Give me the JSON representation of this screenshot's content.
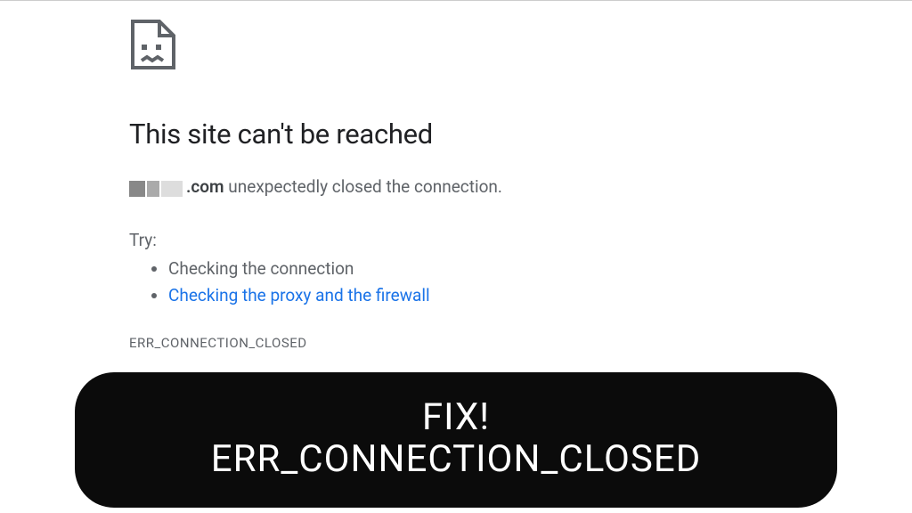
{
  "error": {
    "heading": "This site can't be reached",
    "domain_suffix": ".com",
    "message_rest": " unexpectedly closed the connection.",
    "try_label": "Try:",
    "suggestions": {
      "check_connection": "Checking the connection",
      "check_proxy_firewall": "Checking the proxy and the firewall"
    },
    "error_code": "ERR_CONNECTION_CLOSED"
  },
  "overlay": {
    "line1": "FIX!",
    "line2": "ERR_CONNECTION_CLOSED"
  },
  "colors": {
    "link": "#1a73e8",
    "text_primary": "#202124",
    "text_secondary": "#5f6368",
    "banner_bg": "#0b0b0b"
  }
}
